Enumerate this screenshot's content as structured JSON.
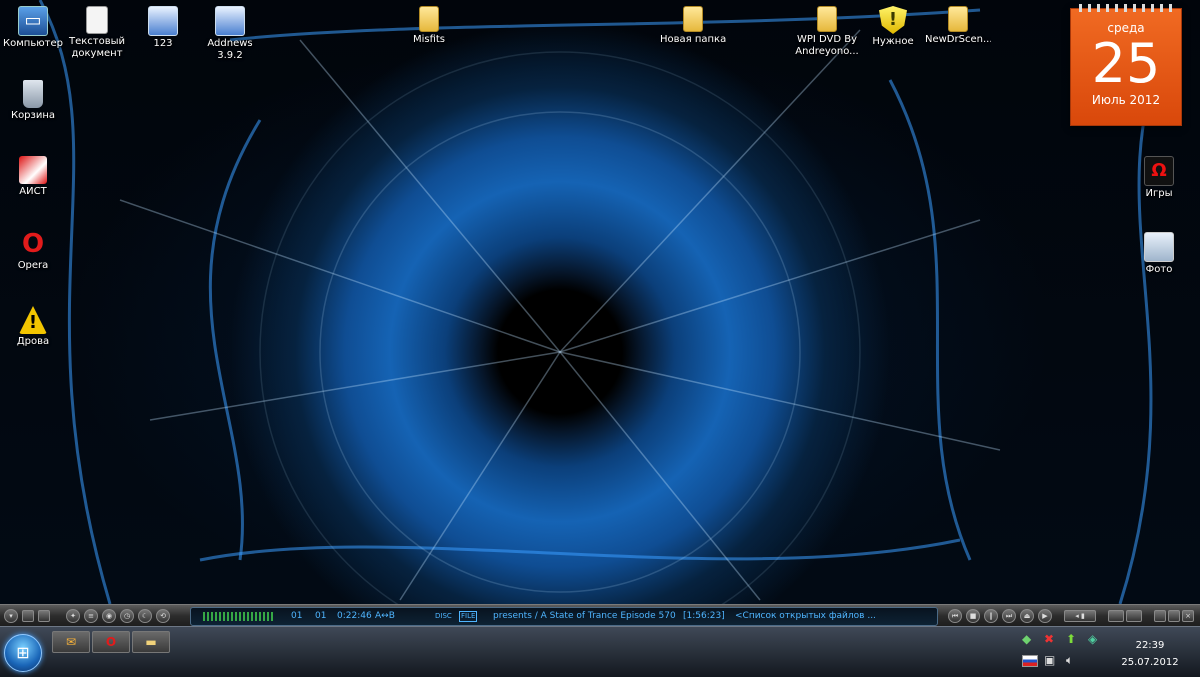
{
  "desktop": {
    "icons_left": [
      {
        "label": "Компьютер",
        "icon": "computer-icon"
      },
      {
        "label": "Корзина",
        "icon": "recycle-bin-icon"
      },
      {
        "label": "АИСТ",
        "icon": "aist-shortcut-icon"
      },
      {
        "label": "Opera",
        "icon": "opera-icon"
      },
      {
        "label": "Дрова",
        "icon": "warning-icon"
      }
    ],
    "icons_top": [
      {
        "label": "Текстовый документ",
        "icon": "text-document-icon"
      },
      {
        "label": "123",
        "icon": "network-shortcut-icon"
      },
      {
        "label": "Addnews 3.9.2",
        "icon": "app-shortcut-icon"
      },
      {
        "label": "Misfits",
        "icon": "folder-icon"
      },
      {
        "label": "Новая папка",
        "icon": "folder-icon"
      },
      {
        "label": "WPI DVD By Andreyono...",
        "icon": "folder-icon"
      },
      {
        "label": "Нужное",
        "icon": "shield-icon"
      },
      {
        "label": "NewDrScen...",
        "icon": "folder-icon"
      }
    ],
    "icons_right": [
      {
        "label": "Игры",
        "icon": "games-icon"
      },
      {
        "label": "Фото",
        "icon": "photo-icon"
      }
    ]
  },
  "calendar": {
    "weekday": "среда",
    "day": "25",
    "month_year": "Июль 2012",
    "color": "#e55a15"
  },
  "player": {
    "track_num": "01",
    "track_num2": "01",
    "time": "0:22:46",
    "mode": "A↔B",
    "disc": "DISC",
    "file": "FILE",
    "title": "presents / A State of Trance Episode 570",
    "duration": "[1:56:23]",
    "playlist": "<Список открытых файлов ...",
    "accent": "#4fb5ff"
  },
  "taskbar": {
    "time": "22:39",
    "date": "25.07.2012",
    "tray_icons": [
      "network-icon",
      "antivirus-icon",
      "update-arrow-icon",
      "green-app-icon",
      "language-ru-icon",
      "monitor-icon",
      "volume-icon"
    ]
  }
}
